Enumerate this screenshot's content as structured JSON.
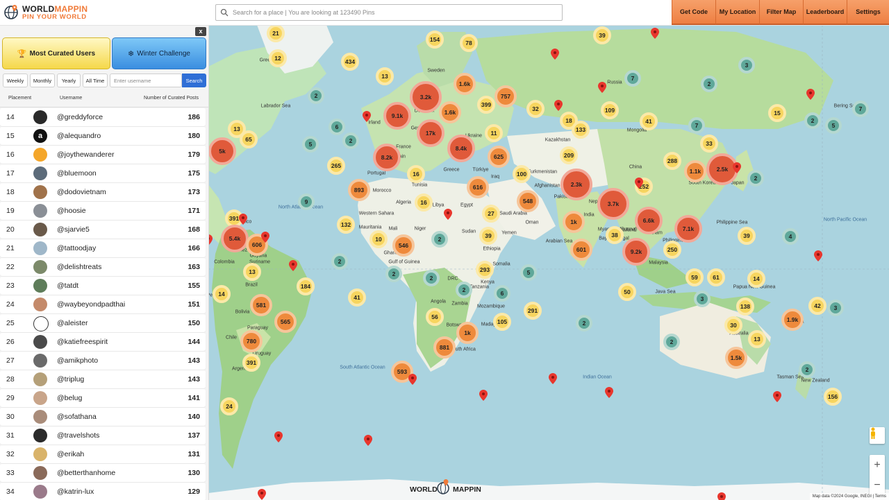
{
  "header": {
    "logo_title_a": "WORLD",
    "logo_title_b": "MAPPIN",
    "logo_sub": "PIN YOUR WORLD",
    "search_placeholder": "Search for a place | You are looking at 123490 Pins",
    "nav": [
      "Get Code",
      "My Location",
      "Filter Map",
      "Leaderboard",
      "Settings"
    ]
  },
  "sidebar": {
    "close": "x",
    "tab_curated": "Most Curated Users",
    "tab_winter": "Winter Challenge",
    "filters": [
      "Weekly",
      "Monthly",
      "Yearly",
      "All Time"
    ],
    "username_placeholder": "Enter username",
    "search_label": "Search",
    "columns": {
      "placement": "Placement",
      "username": "Username",
      "posts": "Number of Curated Posts"
    },
    "rows": [
      {
        "rank": "14",
        "user": "@greddyforce",
        "posts": "186",
        "avatar_color": "#2a2a2a"
      },
      {
        "rank": "15",
        "user": "@alequandro",
        "posts": "180",
        "avatar_color": "#111111",
        "avatar_letter": "a"
      },
      {
        "rank": "16",
        "user": "@joythewanderer",
        "posts": "179",
        "avatar_color": "#f4a62a"
      },
      {
        "rank": "17",
        "user": "@bluemoon",
        "posts": "175",
        "avatar_color": "#5c6b7a"
      },
      {
        "rank": "18",
        "user": "@dodovietnam",
        "posts": "173",
        "avatar_color": "#a0724a"
      },
      {
        "rank": "19",
        "user": "@hoosie",
        "posts": "171",
        "avatar_color": "#8a8f96"
      },
      {
        "rank": "20",
        "user": "@sjarvie5",
        "posts": "168",
        "avatar_color": "#6a5a4a"
      },
      {
        "rank": "21",
        "user": "@tattoodjay",
        "posts": "166",
        "avatar_color": "#9fb7c9"
      },
      {
        "rank": "22",
        "user": "@delishtreats",
        "posts": "163",
        "avatar_color": "#7c8a6a"
      },
      {
        "rank": "23",
        "user": "@tatdt",
        "posts": "155",
        "avatar_color": "#5e7d5a"
      },
      {
        "rank": "24",
        "user": "@waybeyondpadthai",
        "posts": "151",
        "avatar_color": "#c48a6a"
      },
      {
        "rank": "25",
        "user": "@aleister",
        "posts": "150",
        "avatar_color": "#ffffff"
      },
      {
        "rank": "26",
        "user": "@katiefreespirit",
        "posts": "144",
        "avatar_color": "#4a4a4a"
      },
      {
        "rank": "27",
        "user": "@amikphoto",
        "posts": "143",
        "avatar_color": "#6a6a6a"
      },
      {
        "rank": "28",
        "user": "@triplug",
        "posts": "143",
        "avatar_color": "#b5a079"
      },
      {
        "rank": "29",
        "user": "@belug",
        "posts": "141",
        "avatar_color": "#c9a58a"
      },
      {
        "rank": "30",
        "user": "@sofathana",
        "posts": "140",
        "avatar_color": "#a98c7a"
      },
      {
        "rank": "31",
        "user": "@travelshots",
        "posts": "137",
        "avatar_color": "#2a2a2a"
      },
      {
        "rank": "32",
        "user": "@erikah",
        "posts": "131",
        "avatar_color": "#d9b36a"
      },
      {
        "rank": "33",
        "user": "@betterthanhome",
        "posts": "130",
        "avatar_color": "#8a6a5a"
      },
      {
        "rank": "34",
        "user": "@katrin-lux",
        "posts": "129",
        "avatar_color": "#9a7a8a"
      }
    ]
  },
  "map": {
    "labels": [
      "Sweden",
      "Russia",
      "Irland",
      "Denmark",
      "Germany",
      "France",
      "Portugal",
      "Tunisia",
      "Libya",
      "Egypt",
      "Algeria",
      "Morocco",
      "Western Sahara",
      "Mauritania",
      "Mali",
      "Niger",
      "Sudan",
      "Ethiopia",
      "Somalia",
      "Kenya",
      "Tanzania",
      "Angola",
      "Zambia",
      "Mozambique",
      "Botswana",
      "South Africa",
      "Ukraine",
      "Kazakhstan",
      "Türkiye",
      "Greece",
      "Iraq",
      "Iran",
      "Saudi Arabia",
      "Oman",
      "Yemen",
      "Turkmenistan",
      "Afghanistan",
      "Pakistan",
      "India",
      "Nepal",
      "Myanmar (Burma)",
      "Thailand",
      "Vietnam",
      "Philippines",
      "Malaysia",
      "China",
      "Mongolia",
      "Japan",
      "South Korea",
      "Papua New Guinea",
      "Australia",
      "New Zealand",
      "Greenland",
      "Colombia",
      "Venezuela",
      "Guyana",
      "Suriname",
      "Brazil",
      "Peru",
      "Bolivia",
      "Paraguay",
      "Chile",
      "Uruguay",
      "Argentina",
      "Puerto Rico",
      "Ghana",
      "DRC",
      "Spain",
      "Labrador Sea",
      "Bering Sea",
      "Java Sea",
      "Coral Sea",
      "Tasman Sea",
      "Philippine Sea",
      "Arabian Sea",
      "Bay of Bengal",
      "Gulf of Guinea",
      "Madagascar"
    ],
    "oceans": [
      "North Atlantic Ocean",
      "South Atlantic Ocean",
      "North Pacific Ocean",
      "Indian Ocean"
    ],
    "clusters": [
      "21",
      "12",
      "434",
      "13",
      "154",
      "78",
      "39",
      "2",
      "3",
      "2",
      "7",
      "6",
      "3.2k",
      "1.6k",
      "757",
      "399",
      "32",
      "109",
      "9.1k",
      "1.6k",
      "11",
      "18",
      "15",
      "41",
      "13",
      "65",
      "7",
      "2",
      "17k",
      "8.4k",
      "625",
      "133",
      "5",
      "2",
      "5k",
      "265",
      "8.2k",
      "16",
      "209",
      "33",
      "7",
      "5",
      "288",
      "1.1k",
      "2.5k",
      "893",
      "616",
      "100",
      "2.3k",
      "252",
      "2",
      "9",
      "16",
      "27",
      "548",
      "3.7k",
      "6.6k",
      "7.1k",
      "391",
      "132",
      "1k",
      "39",
      "4",
      "5.4k",
      "606",
      "10",
      "546",
      "2",
      "601",
      "38",
      "9.2k",
      "250",
      "2",
      "39",
      "13",
      "2",
      "293",
      "184",
      "2",
      "5",
      "61",
      "59",
      "14",
      "14",
      "581",
      "41",
      "2",
      "6",
      "50",
      "3",
      "138",
      "42",
      "3",
      "565",
      "56",
      "291",
      "2",
      "105",
      "30",
      "1.9k",
      "780",
      "1k",
      "881",
      "1.5k",
      "13",
      "391",
      "2",
      "593",
      "2",
      "156",
      "24"
    ],
    "attribution": "Map data ©2024 Google, INEGI  |  Terms",
    "watermark_a": "WORLD",
    "watermark_b": "MAPPIN"
  },
  "colors": {
    "accent": "#f07b3a",
    "search_blue": "#2f6fd6",
    "cluster_red": "#e05a3a",
    "cluster_orange": "#f29a4a",
    "cluster_yellow": "#f6d36a",
    "cluster_teal": "#5fa89a"
  },
  "icons": [
    "globe-pin-icon",
    "search-icon",
    "trophy-icon",
    "snowflake-icon",
    "map-pin-icon",
    "pegman-icon",
    "zoom-in-icon",
    "zoom-out-icon"
  ]
}
